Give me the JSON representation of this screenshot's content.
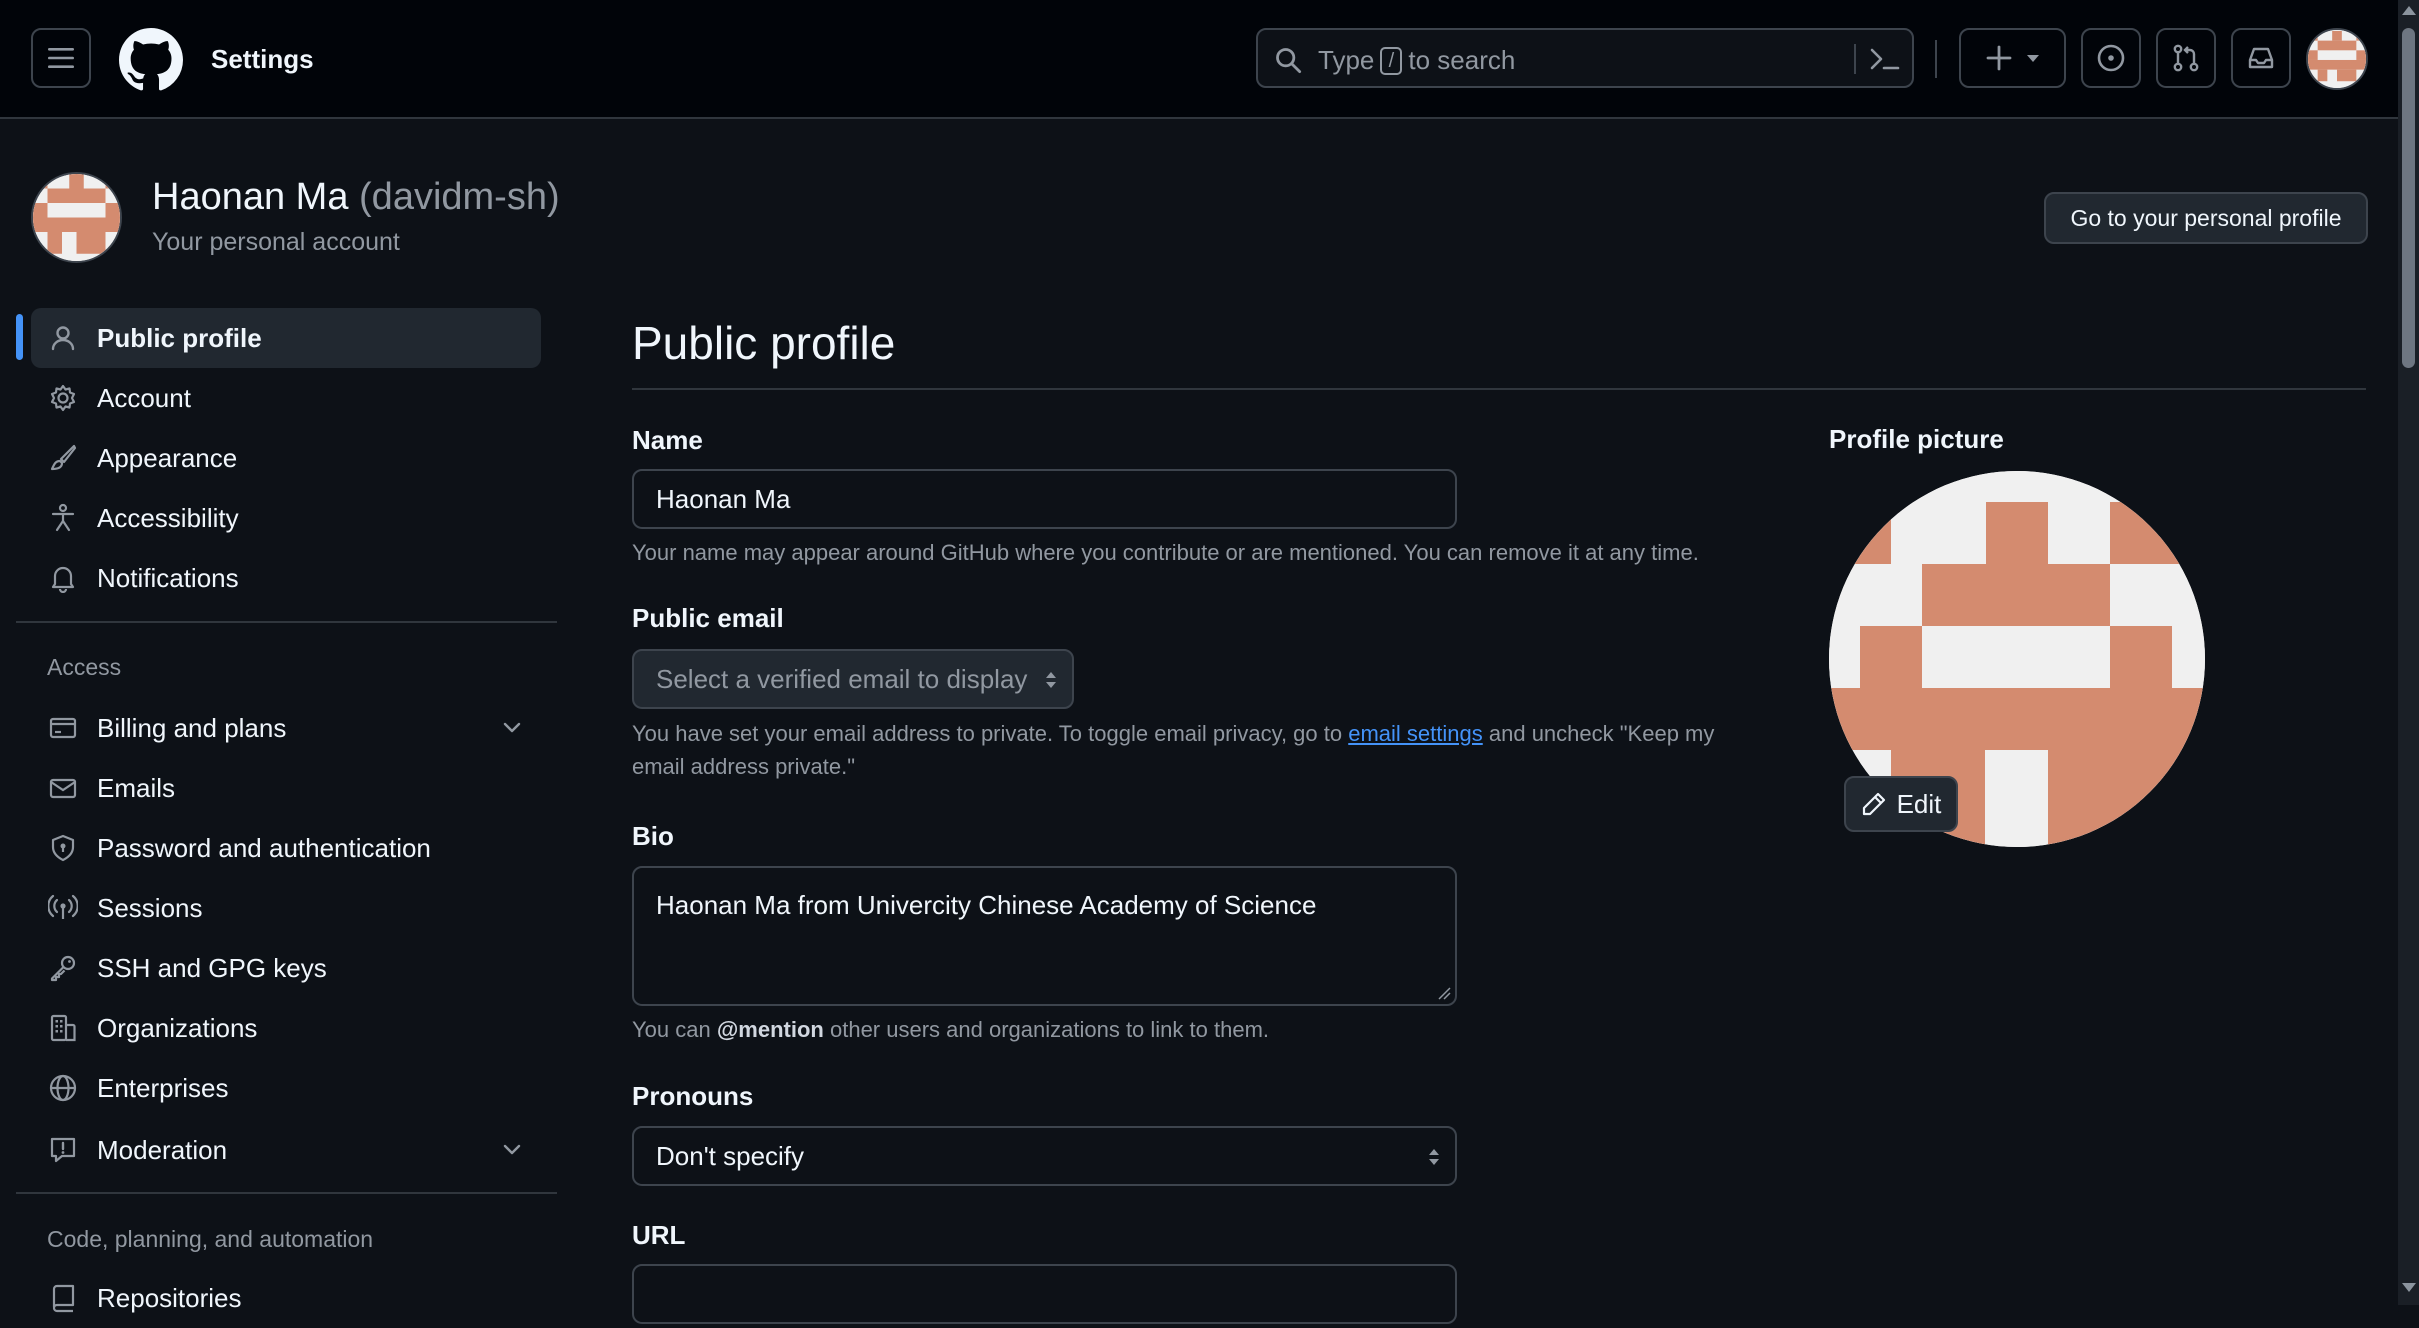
{
  "header": {
    "title": "Settings",
    "search_type": "Type",
    "search_key": "/",
    "search_rest": "to search"
  },
  "account": {
    "name": "Haonan Ma",
    "login": "(davidm-sh)",
    "subtitle": "Your personal account",
    "profile_button": "Go to your personal profile"
  },
  "sidebar": {
    "items": [
      {
        "label": "Public profile",
        "icon": "person-icon",
        "active": true
      },
      {
        "label": "Account",
        "icon": "gear-icon"
      },
      {
        "label": "Appearance",
        "icon": "paintbrush-icon"
      },
      {
        "label": "Accessibility",
        "icon": "accessibility-icon"
      },
      {
        "label": "Notifications",
        "icon": "bell-icon"
      }
    ],
    "access_heading": "Access",
    "access_items": [
      {
        "label": "Billing and plans",
        "icon": "credit-card-icon",
        "expandable": true
      },
      {
        "label": "Emails",
        "icon": "mail-icon"
      },
      {
        "label": "Password and authentication",
        "icon": "shield-lock-icon"
      },
      {
        "label": "Sessions",
        "icon": "broadcast-icon"
      },
      {
        "label": "SSH and GPG keys",
        "icon": "key-icon"
      },
      {
        "label": "Organizations",
        "icon": "organization-icon"
      },
      {
        "label": "Enterprises",
        "icon": "globe-icon"
      },
      {
        "label": "Moderation",
        "icon": "report-icon",
        "expandable": true
      }
    ],
    "code_heading": "Code, planning, and automation",
    "code_items": [
      {
        "label": "Repositories",
        "icon": "repo-icon"
      }
    ]
  },
  "main": {
    "title": "Public profile",
    "name_label": "Name",
    "name_value": "Haonan Ma",
    "name_note": "Your name may appear around GitHub where you contribute or are mentioned. You can remove it at any time.",
    "email_label": "Public email",
    "email_placeholder": "Select a verified email to display",
    "email_note_1": "You have set your email address to private. To toggle email privacy, go to",
    "email_link": "email settings",
    "email_note_2": "and uncheck \"Keep my",
    "email_note_3": "email address private.\"",
    "bio_label": "Bio",
    "bio_value": "Haonan Ma from Univercity Chinese Academy of Science",
    "bio_note_1": "You can",
    "bio_mention": "@mention",
    "bio_note_2": "other users and organizations to link to them.",
    "pronouns_label": "Pronouns",
    "pronouns_value": "Don't specify",
    "url_label": "URL",
    "url_value": ""
  },
  "profile_picture": {
    "label": "Profile picture",
    "edit_label": "Edit"
  },
  "colors": {
    "background": "#0d1117",
    "header": "#010409",
    "accent": "#4493f8",
    "avatar": "#d48b6f"
  }
}
